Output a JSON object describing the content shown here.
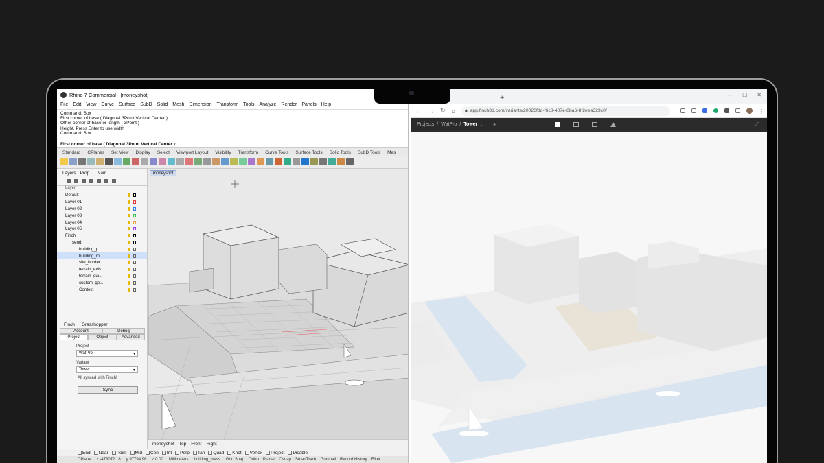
{
  "rhino": {
    "title": "Rhino 7 Commercial - [moneyshot]",
    "menu": [
      "File",
      "Edit",
      "View",
      "Curve",
      "Surface",
      "SubD",
      "Solid",
      "Mesh",
      "Dimension",
      "Transform",
      "Tools",
      "Analyze",
      "Render",
      "Panels",
      "Help"
    ],
    "command_history": [
      "Command: Box",
      "First corner of base ( Diagonal  3Point  Vertical  Center )",
      "Other corner of base or length ( 3Point )",
      "Height. Press Enter to use width",
      "Command: Box"
    ],
    "prompt": "First corner of base ( Diagonal  3Point  Vertical  Center ):",
    "toolbar_tabs": [
      "Standard",
      "CPlanes",
      "Set View",
      "Display",
      "Select",
      "Viewport Layout",
      "Visibility",
      "Transform",
      "Curve Tools",
      "Surface Tools",
      "Solid Tools",
      "SubD Tools",
      "Mes"
    ],
    "panel_tabs": [
      "Layers",
      "Prop...",
      "Nam..."
    ],
    "layer_header": "Layer",
    "layers": [
      {
        "name": "Default",
        "indent": 0,
        "color": "#000000"
      },
      {
        "name": "Layer 01",
        "indent": 0,
        "color": "#e33b3b"
      },
      {
        "name": "Layer 02",
        "indent": 0,
        "color": "#3b7fe3"
      },
      {
        "name": "Layer 03",
        "indent": 0,
        "color": "#3bbf5a"
      },
      {
        "name": "Layer 04",
        "indent": 0,
        "color": "#e3a23b"
      },
      {
        "name": "Layer 05",
        "indent": 0,
        "color": "#9b3be3"
      },
      {
        "name": "Finch",
        "indent": 0,
        "color": "#000000"
      },
      {
        "name": "send",
        "indent": 1,
        "color": "#000000"
      },
      {
        "name": "building_p...",
        "indent": 2,
        "color": "#666666"
      },
      {
        "name": "building_m...",
        "indent": 2,
        "color": "#666666",
        "selected": true
      },
      {
        "name": "site_border",
        "indent": 2,
        "color": "#666666"
      },
      {
        "name": "terrain_exis...",
        "indent": 2,
        "color": "#666666"
      },
      {
        "name": "terrain_gui...",
        "indent": 2,
        "color": "#666666"
      },
      {
        "name": "custom_ge...",
        "indent": 2,
        "color": "#666666"
      },
      {
        "name": "Context",
        "indent": 2,
        "color": "#666666"
      }
    ],
    "finch_tabs": [
      "Finch",
      "Grasshopper"
    ],
    "finch_subtabs_row1": [
      "Account",
      "Debug"
    ],
    "finch_subtabs_row2": [
      "Project",
      "Object",
      "Advanced"
    ],
    "project_label": "Project",
    "project_value": "WatPro",
    "variant_label": "Variant",
    "variant_value": "Tower",
    "sync_status": "All synced with Finch!",
    "sync_button": "Sync",
    "viewport_tab": "moneyshot",
    "viewport_tabs": [
      "moneyshot",
      "Top",
      "Front",
      "Right"
    ],
    "osnaps": [
      "End",
      "Near",
      "Point",
      "Mid",
      "Cen",
      "Int",
      "Perp",
      "Tan",
      "Quad",
      "Knot",
      "Vertex",
      "Project",
      "Disable"
    ],
    "status": {
      "cplane": "CPlane",
      "x": "x -473072.18",
      "y": "y 97794.96",
      "z": "z 0.00",
      "units": "Millimeters",
      "layer": "building_mass",
      "toggles": [
        "Grid Snap",
        "Ortho",
        "Planar",
        "Osnap",
        "SmartTrack",
        "Gumball",
        "Record History",
        "Filter"
      ]
    }
  },
  "browser": {
    "url": "app.finch3d.com/variants/20026fdd-f6c8-407e-8ba6-8f2eea323c0f",
    "breadcrumb": [
      "Projects",
      "WatPro",
      "Tower"
    ]
  },
  "colors": {
    "background": "#1b1b1b",
    "app_bar": "#2b2b2b",
    "selection": "#cfe0fb",
    "water": "#cfe0f0"
  }
}
